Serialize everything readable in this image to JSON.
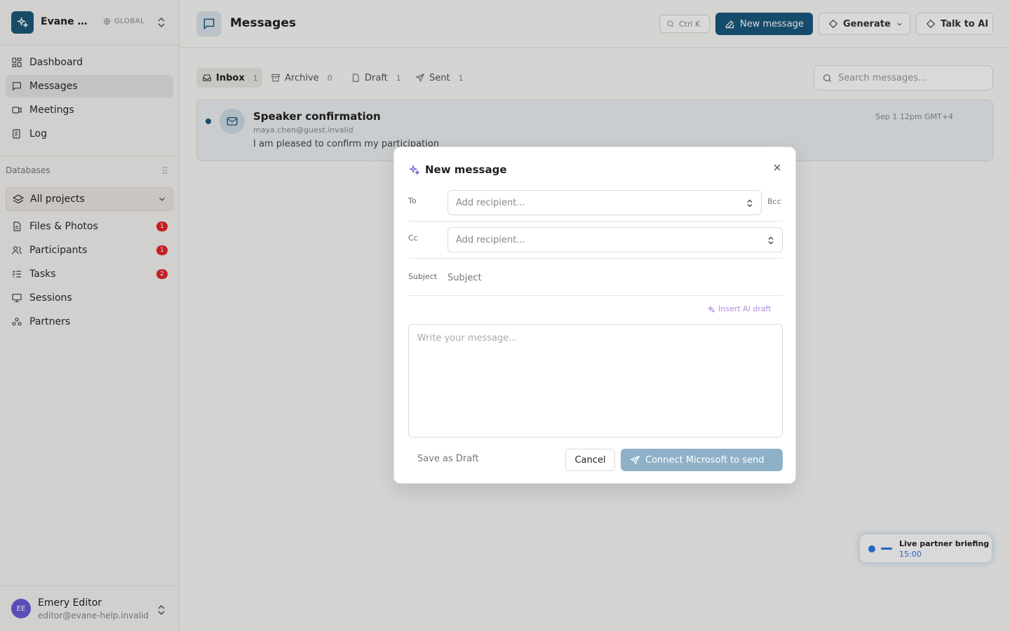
{
  "workspace": {
    "name": "Evane Help",
    "scope": "GLOBAL"
  },
  "sidebar": {
    "nav": [
      {
        "label": "Dashboard",
        "icon": "grid-icon"
      },
      {
        "label": "Messages",
        "icon": "chat-icon",
        "active": true
      },
      {
        "label": "Meetings",
        "icon": "video-icon"
      },
      {
        "label": "Log",
        "icon": "log-icon"
      }
    ],
    "databases_label": "Databases",
    "projects_select": "All projects",
    "databases": [
      {
        "label": "Files & Photos",
        "badge": "1"
      },
      {
        "label": "Participants",
        "badge": "1"
      },
      {
        "label": "Tasks",
        "badge": "2"
      },
      {
        "label": "Sessions",
        "badge": ""
      },
      {
        "label": "Partners",
        "badge": ""
      }
    ]
  },
  "user": {
    "initials": "EE",
    "name": "Emery Editor",
    "email": "editor@evane-help.invalid"
  },
  "header": {
    "title": "Messages",
    "shortcut": "Ctrl K",
    "new_message": "New message",
    "generate": "Generate",
    "talk_to_ai": "Talk to AI"
  },
  "tabs": [
    {
      "label": "Inbox",
      "count": "1"
    },
    {
      "label": "Archive",
      "count": "0"
    },
    {
      "label": "Draft",
      "count": "1"
    },
    {
      "label": "Sent",
      "count": "1"
    }
  ],
  "search": {
    "placeholder": "Search messages..."
  },
  "messages": [
    {
      "subject": "Speaker confirmation",
      "from": "maya.chen@guest.invalid",
      "preview": "I am pleased to confirm my participation",
      "date": "Sep 1 12pm GMT+4"
    }
  ],
  "live": {
    "title": "Live partner briefing",
    "time": "15:00"
  },
  "modal": {
    "title": "New message",
    "to_label": "To",
    "cc_label": "Cc",
    "bcc_label": "Bcc",
    "subject_label": "Subject",
    "recipient_placeholder": "Add recipient...",
    "subject_placeholder": "Subject",
    "insert_ai": "Insert AI draft",
    "body_placeholder": "Write your message...",
    "save_draft": "Save as Draft",
    "cancel": "Cancel",
    "connect": "Connect Microsoft to send"
  },
  "colors": {
    "brand": "#1b5a7e",
    "badge": "#e5252a",
    "ai": "#b58ce0",
    "connect": "#8eb1c8"
  }
}
